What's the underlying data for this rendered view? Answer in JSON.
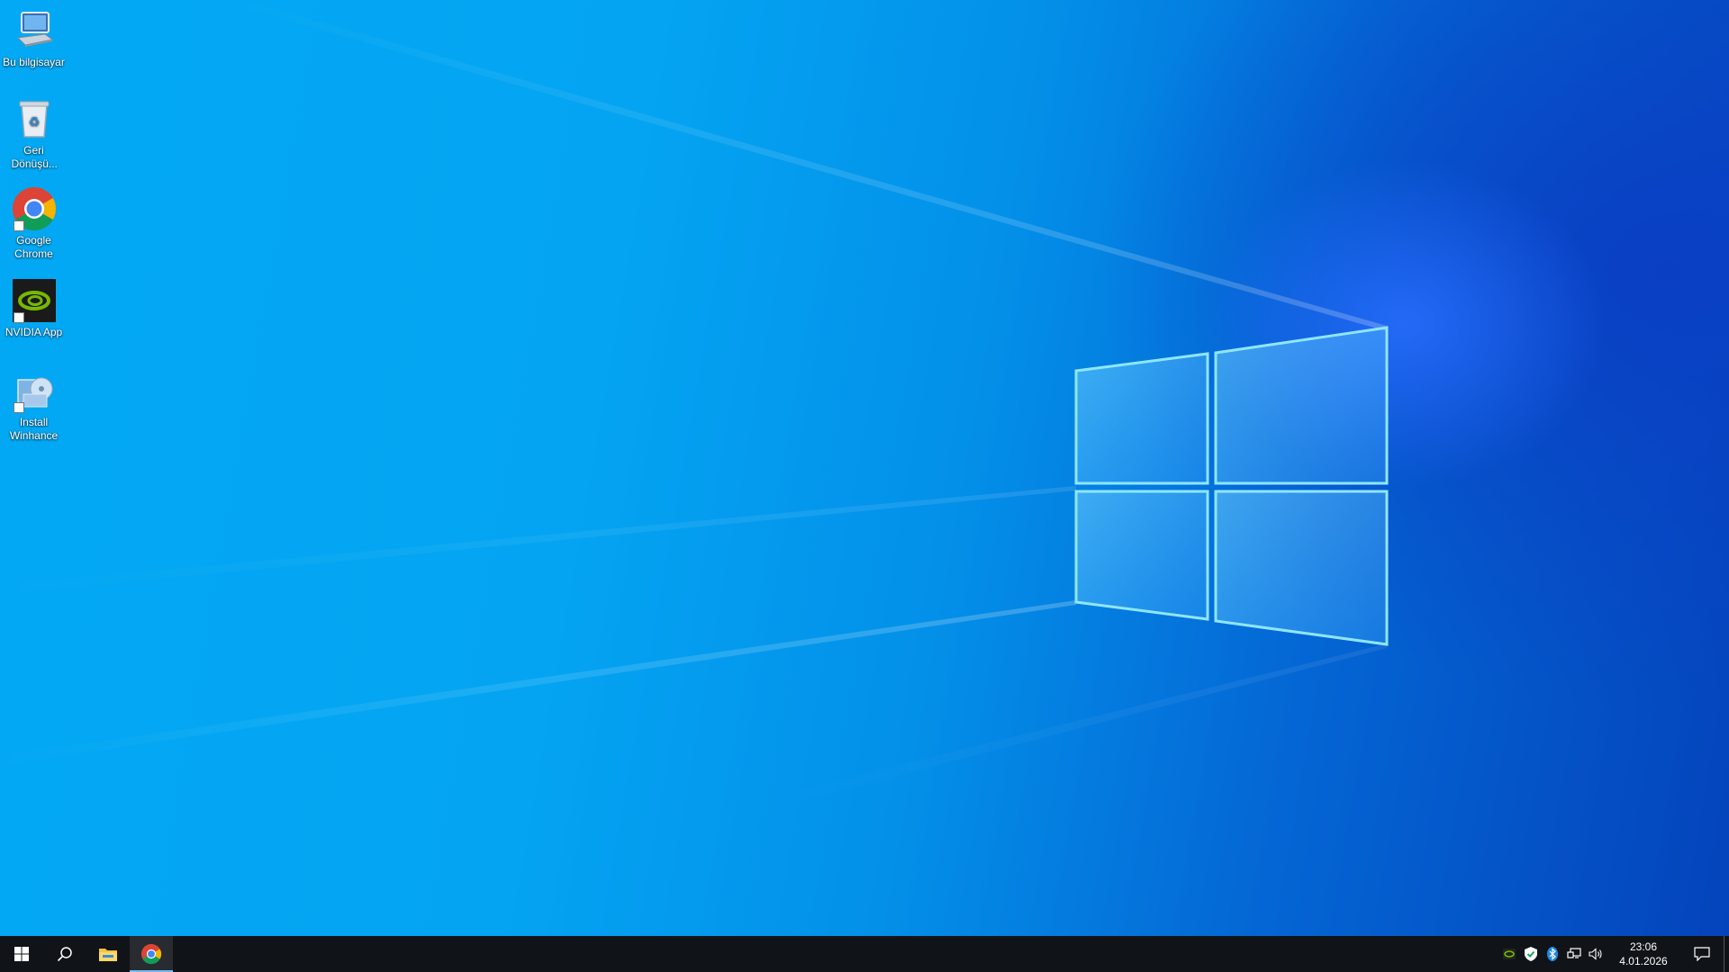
{
  "desktop": {
    "icons": [
      {
        "label": "Bu bilgisayar",
        "icon": "this-pc-icon"
      },
      {
        "label": "Geri Dönüşü...",
        "icon": "recycle-bin-icon"
      },
      {
        "label": "Google Chrome",
        "icon": "chrome-icon"
      },
      {
        "label": "NVIDIA App",
        "icon": "nvidia-icon"
      },
      {
        "label": "Install Winhance",
        "icon": "installer-icon"
      }
    ]
  },
  "taskbar": {
    "start": {
      "icon": "windows-logo-icon"
    },
    "search": {
      "icon": "search-icon"
    },
    "pinned": [
      {
        "name": "File Explorer",
        "icon": "folder-icon"
      },
      {
        "name": "Google Chrome",
        "icon": "chrome-icon",
        "active": true
      }
    ],
    "tray": {
      "icons": [
        "nvidia-tray-icon",
        "security-shield-icon",
        "bluetooth-icon",
        "network-icon",
        "volume-icon"
      ],
      "time": "23:06",
      "date": "4.01.2026"
    },
    "action_center": {
      "icon": "notification-icon"
    }
  },
  "colors": {
    "accent": "#76b9ed",
    "taskbar_bg": "#101418",
    "wallpaper_light": "#03a9f4",
    "wallpaper_dark": "#0443bb"
  }
}
